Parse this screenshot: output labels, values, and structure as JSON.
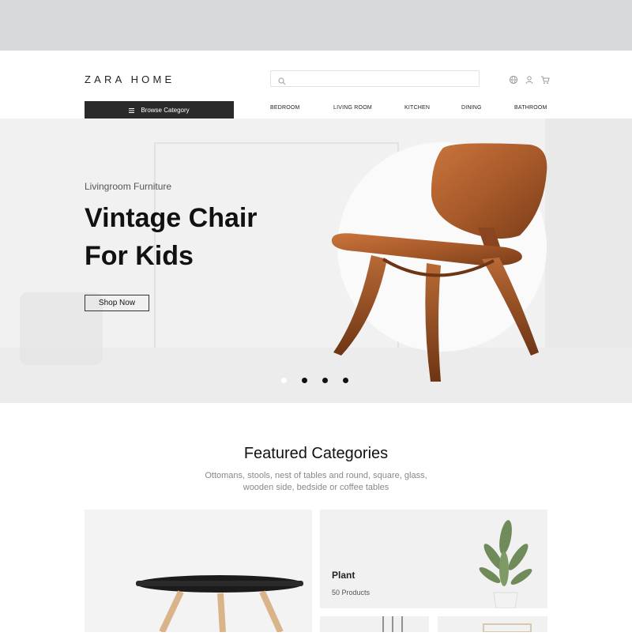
{
  "brand": {
    "logo_text": "ZARA HOME"
  },
  "header": {
    "search": {
      "placeholder": ""
    },
    "icons": [
      "globe-icon",
      "user-icon",
      "cart-icon"
    ]
  },
  "nav": {
    "browse_label": "Browse Category",
    "items": [
      "BEDROOM",
      "LIVING ROOM",
      "KITCHEN",
      "DINING",
      "BATHROOM"
    ]
  },
  "hero": {
    "kicker": "Livingroom Furniture",
    "title_line1": "Vintage Chair",
    "title_line2": "For Kids",
    "cta_label": "Shop Now",
    "slides": 4,
    "active_slide": 1
  },
  "featured": {
    "title": "Featured Categories",
    "subtitle_line1": "Ottomans, stools, nest of tables and round, square, glass,",
    "subtitle_line2": "wooden side, bedside or coffee tables",
    "cards": [
      {
        "name": "",
        "count": ""
      },
      {
        "name": "Plant",
        "count": "50 Products"
      },
      {
        "name": "",
        "count": ""
      },
      {
        "name": "",
        "count": ""
      }
    ]
  },
  "colors": {
    "dark": "#2a2a2a",
    "accent_wood": "#a0522d",
    "band": "#d8d9db"
  }
}
